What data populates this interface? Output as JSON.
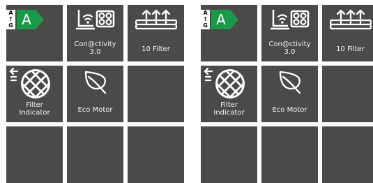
{
  "panels": [
    {
      "tiles": [
        {
          "name": "energy-label",
          "scale_top": "A",
          "scale_mid": "↑",
          "scale_bottom": "G",
          "grade": "A"
        },
        {
          "name": "connectivity",
          "label_line1": "Con@ctivity",
          "label_line2": "3.0"
        },
        {
          "name": "filter-10",
          "label": "10 Filter"
        },
        {
          "name": "filter-indicator",
          "label_line1": "Filter",
          "label_line2": "Indicator"
        },
        {
          "name": "eco-motor",
          "label": "Eco Motor"
        }
      ]
    },
    {
      "tiles": [
        {
          "name": "energy-label",
          "scale_top": "A",
          "scale_mid": "↑",
          "scale_bottom": "G",
          "grade": "A"
        },
        {
          "name": "connectivity",
          "label_line1": "Con@ctivity",
          "label_line2": "3.0"
        },
        {
          "name": "filter-10",
          "label": "10 Filter"
        },
        {
          "name": "filter-indicator",
          "label_line1": "Filter",
          "label_line2": "Indicator"
        },
        {
          "name": "eco-motor",
          "label": "Eco Motor"
        }
      ]
    }
  ],
  "colors": {
    "tile_background": "#4a4a48",
    "energy_green": "#1a9a48",
    "icon_white": "#ffffff"
  },
  "icons": [
    "energy-label-icon",
    "connectivity-icon",
    "ten-filter-icon",
    "filter-indicator-icon",
    "leaf-icon"
  ]
}
